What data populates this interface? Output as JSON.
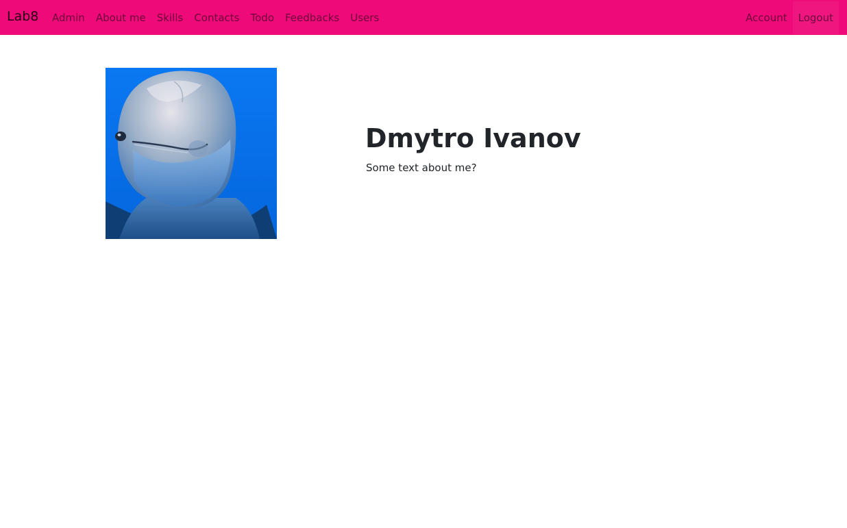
{
  "navbar": {
    "brand": "Lab8",
    "left_items": [
      {
        "label": "Admin"
      },
      {
        "label": "About me"
      },
      {
        "label": "Skills"
      },
      {
        "label": "Contacts"
      },
      {
        "label": "Todo"
      },
      {
        "label": "Feedbacks"
      },
      {
        "label": "Users"
      }
    ],
    "right_items": [
      {
        "label": "Account"
      },
      {
        "label": "Logout"
      }
    ],
    "color": "#ef0a7a"
  },
  "profile": {
    "name": "Dmytro Ivanov",
    "about": "Some text about me?",
    "photo_subject": "dolphin-photo"
  }
}
